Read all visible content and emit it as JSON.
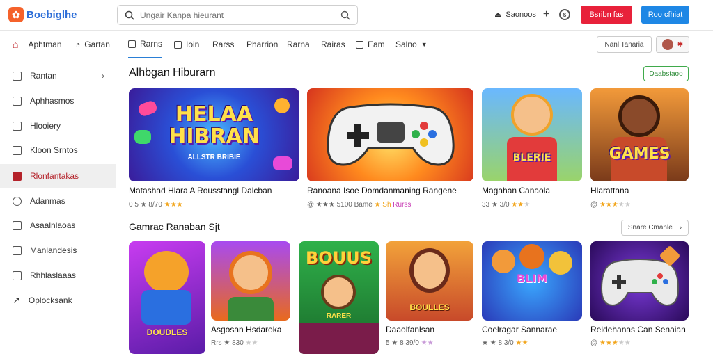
{
  "header": {
    "logo_text": "Boebiglhe",
    "search_placeholder": "Ungair Kanpa hieurant",
    "account_label": "Saonoos",
    "btn_red": "Bsribn fas",
    "btn_blue": "Roo cfhiat"
  },
  "nav": {
    "items": [
      "Aphtman",
      "Gartan",
      "Rarns",
      "Ioin",
      "Rarss",
      "Pharrion",
      "Rarna",
      "Rairas",
      "Eam",
      "Salno"
    ],
    "user_button": "Nanl Tanaria"
  },
  "sidebar": {
    "items": [
      "Rantan",
      "Aphhasmos",
      "Hlooiery",
      "Kloon Srntos",
      "Rlonfantakas",
      "Adanmas",
      "Asaalnlaoas",
      "Manlandesis",
      "Rhhlaslaaas",
      "Oplocksank"
    ]
  },
  "section1": {
    "title": "Alhbgan Hiburarn",
    "pill": "Daabstaoo",
    "cards": [
      {
        "thumb_title": "HELAA HIBRAN",
        "thumb_sub": "ALLSTR BRIBIE",
        "name": "Matashad Hlara A Rousstangl Dalcban",
        "rating": "0 5 ★ 8/70",
        "stars": "★★★",
        "dim": "",
        "tag": ""
      },
      {
        "thumb_title": "",
        "thumb_sub": "",
        "name": "Ranoana Isoe Domdanmaning Rangene",
        "rating": "@ ★★★ 5100 Bame",
        "stars": "★ Sh",
        "dim": "",
        "tag": "Rurss"
      },
      {
        "thumb_title": "",
        "thumb_sub": "BLERIE",
        "name": "Magahan Canaola",
        "rating": "33 ★ 3/0",
        "stars": "★★",
        "dim": "★",
        "tag": ""
      },
      {
        "thumb_title": "GAMES",
        "thumb_sub": "",
        "name": "Hlarattana",
        "rating": "@",
        "stars": "★★★",
        "dim": "★★",
        "tag": ""
      }
    ]
  },
  "section2": {
    "title": "Gamrac Ranaban Sjt",
    "more": "Snare Cmanle",
    "cards": [
      {
        "thumb_title": "",
        "thumb_sub": "DOUDLES",
        "name": "",
        "rating": "",
        "stars": "",
        "dim": "",
        "tag": ""
      },
      {
        "thumb_title": "",
        "thumb_sub": "",
        "name": "Asgosan Hsdaroka",
        "rating": "Rrs ★ 830",
        "stars": "",
        "dim": "★★",
        "tag": ""
      },
      {
        "thumb_title": "BOUUS",
        "thumb_sub": "RARER",
        "name": "",
        "rating": "",
        "stars": "",
        "dim": "",
        "tag": ""
      },
      {
        "thumb_title": "",
        "thumb_sub": "BOULLES",
        "name": "Daaolfanlsan",
        "rating": "5 ★ 8 39/0",
        "stars": "",
        "dim": "★★",
        "tag": ""
      },
      {
        "thumb_title": "BLIM",
        "thumb_sub": "",
        "name": "Coelragar Sannarae",
        "rating": "★ ★ 8 3/0",
        "stars": "★★",
        "dim": "",
        "tag": ""
      },
      {
        "thumb_title": "",
        "thumb_sub": "",
        "name": "Reldehanas Can Senaian",
        "rating": "@",
        "stars": "★★★",
        "dim": "★★",
        "tag": ""
      }
    ]
  },
  "colors": {
    "accent_red": "#e8213a",
    "accent_blue": "#1e87e5",
    "active_tab": "#2a7fd6",
    "green": "#3faa4b"
  }
}
